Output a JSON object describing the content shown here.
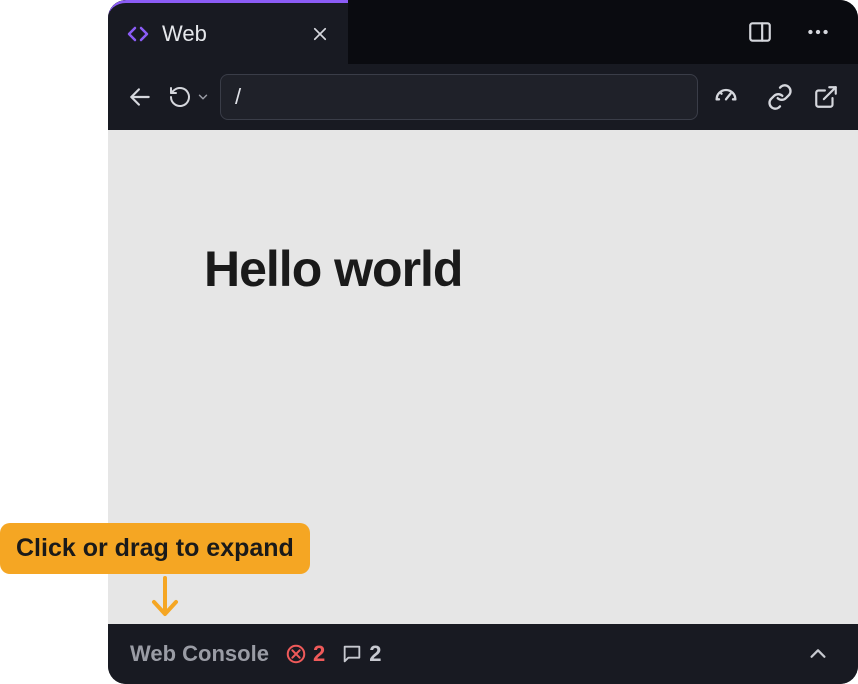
{
  "tab": {
    "title": "Web"
  },
  "toolbar": {
    "url": "/"
  },
  "page": {
    "heading": "Hello world"
  },
  "console": {
    "label": "Web Console",
    "errors": "2",
    "messages": "2"
  },
  "annotation": {
    "text": "Click or drag to expand"
  }
}
